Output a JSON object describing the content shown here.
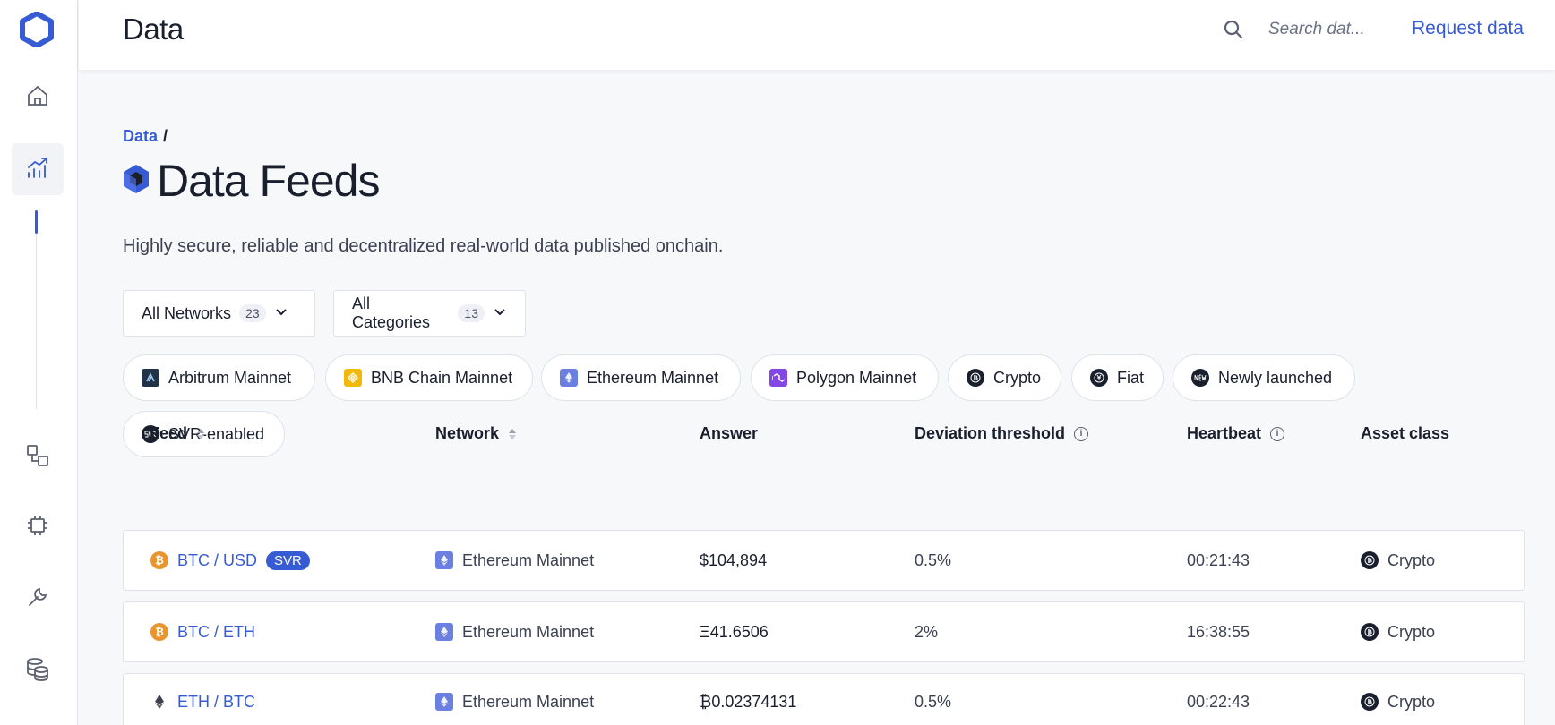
{
  "header": {
    "title": "Data",
    "search_placeholder": "Search dat...",
    "request_label": "Request data"
  },
  "breadcrumb": {
    "root": "Data",
    "separator": "/"
  },
  "page": {
    "title": "Data Feeds",
    "subtitle": "Highly secure, reliable and decentralized real-world data published onchain."
  },
  "filters": {
    "networks": {
      "label": "All Networks",
      "count": "23"
    },
    "categories": {
      "label": "All Categories",
      "count": "13"
    }
  },
  "chips": [
    {
      "label": "Arbitrum Mainnet",
      "icon": "arbitrum-icon"
    },
    {
      "label": "BNB Chain Mainnet",
      "icon": "bnb-icon"
    },
    {
      "label": "Ethereum Mainnet",
      "icon": "ethereum-icon"
    },
    {
      "label": "Polygon Mainnet",
      "icon": "polygon-icon"
    },
    {
      "label": "Crypto",
      "icon": "crypto-icon"
    },
    {
      "label": "Fiat",
      "icon": "fiat-icon"
    },
    {
      "label": "Newly launched",
      "icon": "new-icon"
    },
    {
      "label": "SVR-enabled",
      "icon": "svr-icon"
    }
  ],
  "table": {
    "columns": {
      "feed": "Feed",
      "network": "Network",
      "answer": "Answer",
      "deviation": "Deviation threshold",
      "heartbeat": "Heartbeat",
      "asset_class": "Asset class"
    },
    "rows": [
      {
        "feed": "BTC / USD",
        "badge": "SVR",
        "network": "Ethereum Mainnet",
        "answer": "$104,894",
        "deviation": "0.5%",
        "heartbeat": "00:21:43",
        "asset_class": "Crypto"
      },
      {
        "feed": "BTC / ETH",
        "badge": "",
        "network": "Ethereum Mainnet",
        "answer": "Ξ41.6506",
        "deviation": "2%",
        "heartbeat": "16:38:55",
        "asset_class": "Crypto"
      },
      {
        "feed": "ETH / BTC",
        "badge": "",
        "network": "Ethereum Mainnet",
        "answer": "₿0.02374131",
        "deviation": "0.5%",
        "heartbeat": "00:22:43",
        "asset_class": "Crypto"
      }
    ]
  },
  "colors": {
    "accent": "#375bd2",
    "text": "#1a1f2e",
    "background": "#f7f8fa",
    "border": "#dfe2ea",
    "bitcoin": "#e8952e",
    "ethereum_chip": "#6b7fe0",
    "bnb": "#f0b90b",
    "polygon": "#8247e5"
  },
  "sidebar": {
    "items": [
      "home-icon",
      "data-feeds-icon",
      "ccip-icon",
      "functions-icon",
      "tools-icon",
      "data-streams-icon"
    ]
  }
}
